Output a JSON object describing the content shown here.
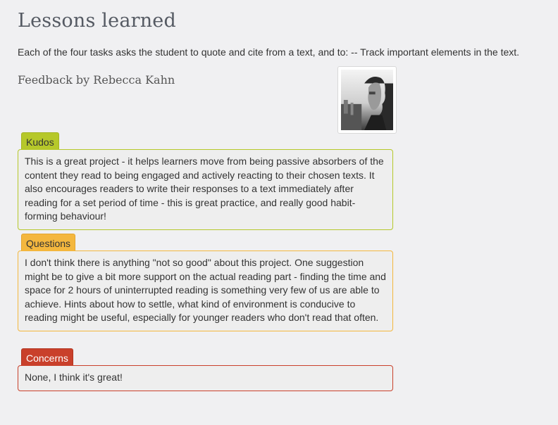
{
  "page": {
    "title": "Lessons learned",
    "intro": "Each of the four tasks asks the student to quote and cite from a text, and to: -- Track important elements in the text.",
    "feedback_by": "Feedback by Rebecca Kahn"
  },
  "sections": {
    "kudos": {
      "label": "Kudos",
      "text": "This is a great project - it helps learners move from being passive absorbers of the content they read to being engaged and actively reacting to their chosen texts. It also encourages readers to write their responses to a text immediately after reading for a set period of time - this is great practice, and really good habit-forming behaviour!"
    },
    "questions": {
      "label": "Questions",
      "text": "I don't think there is anything \"not so good\" about this project. One suggestion might be to give a bit more support on the actual reading part - finding the time and space for 2 hours of uninterrupted reading is something very few of us are able to achieve. Hints about how to settle, what kind of environment is conducive to reading might be useful, especially for younger readers who don't read that often."
    },
    "concerns": {
      "label": "Concerns",
      "text": "None, I think it's great!"
    }
  },
  "colors": {
    "kudos": "#b6c82a",
    "questions": "#f4b73e",
    "concerns": "#c9402b"
  }
}
